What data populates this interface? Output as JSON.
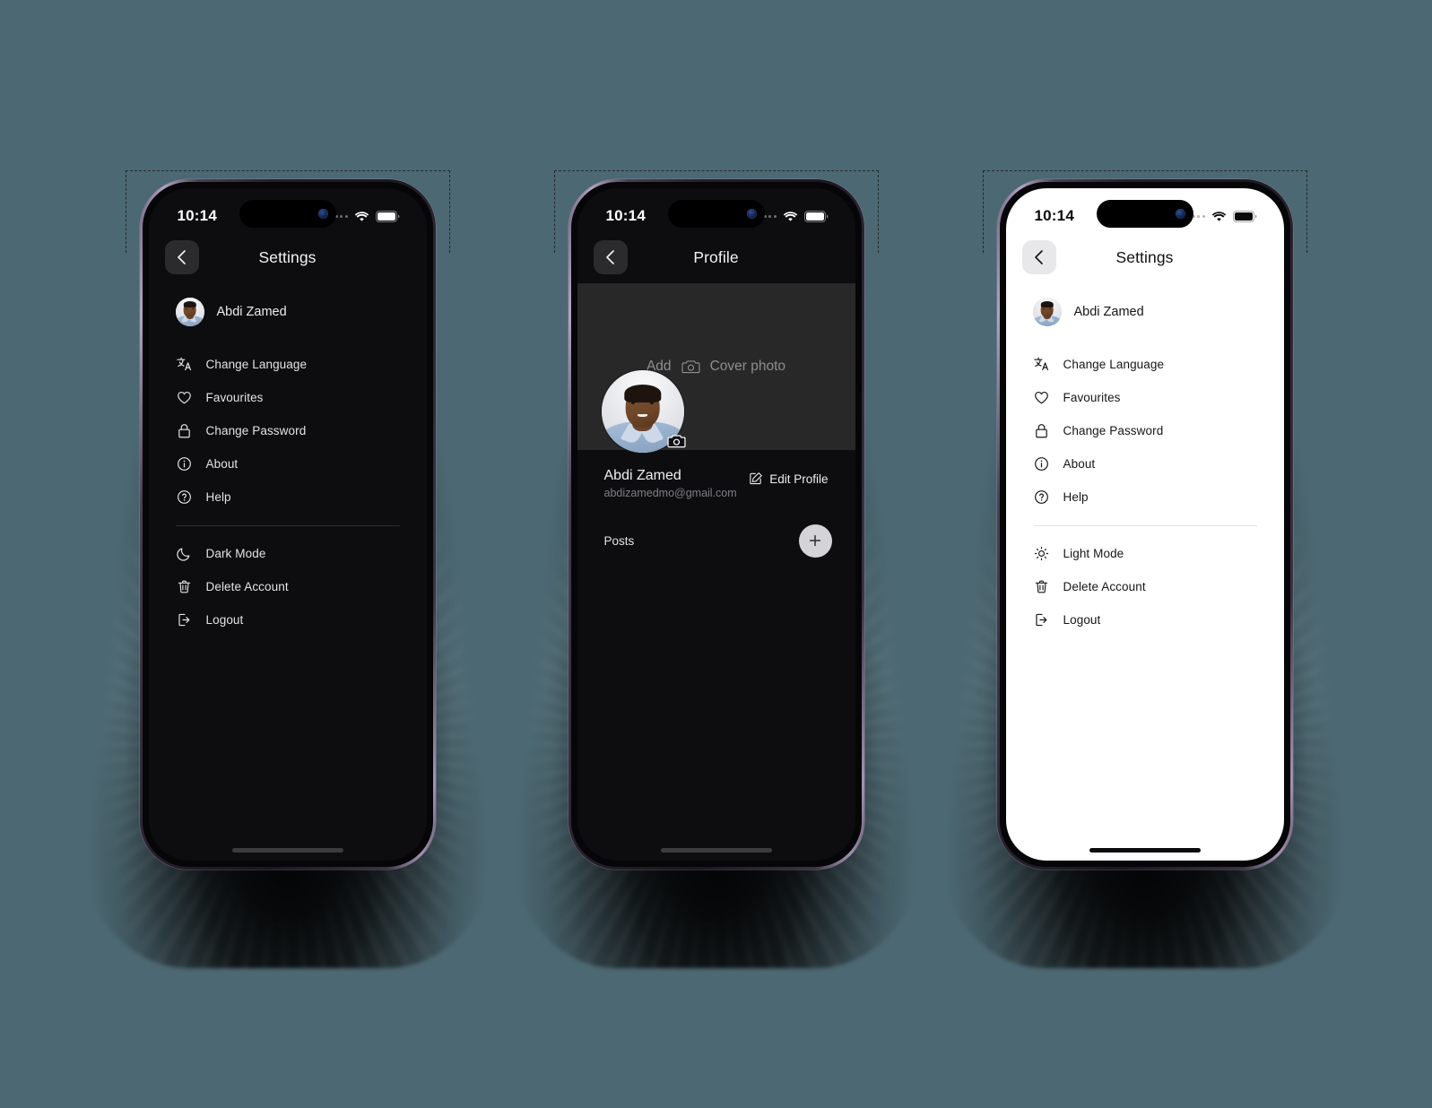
{
  "background_color": "#4c6872",
  "status_bar": {
    "time": "10:14",
    "signal_icon": "signal-dots-icon",
    "wifi_icon": "wifi-icon",
    "battery_icon": "battery-full-icon"
  },
  "phones": [
    {
      "id": "phone-settings-dark",
      "theme": "dark",
      "screen": "settings",
      "nav": {
        "title": "Settings",
        "back_icon": "chevron-left-icon"
      },
      "user": {
        "name": "Abdi Zamed",
        "avatar_icon": "user-avatar"
      },
      "menu_groups": [
        {
          "items": [
            {
              "label": "Change Language",
              "icon": "translate-icon"
            },
            {
              "label": "Favourites",
              "icon": "heart-icon"
            },
            {
              "label": "Change Password",
              "icon": "lock-icon"
            },
            {
              "label": "About",
              "icon": "info-circle-icon"
            },
            {
              "label": "Help",
              "icon": "question-circle-icon"
            }
          ]
        },
        {
          "items": [
            {
              "label": "Dark Mode",
              "icon": "moon-icon"
            },
            {
              "label": "Delete Account",
              "icon": "trash-icon"
            },
            {
              "label": "Logout",
              "icon": "logout-icon"
            }
          ]
        }
      ]
    },
    {
      "id": "phone-profile-dark",
      "theme": "dark",
      "screen": "profile",
      "nav": {
        "title": "Profile",
        "back_icon": "chevron-left-icon"
      },
      "cover": {
        "cta_prefix": "Add",
        "cta_suffix": "Cover photo",
        "camera_icon": "camera-icon"
      },
      "profile": {
        "name": "Abdi Zamed",
        "email": "abdizamedmo@gmail.com",
        "avatar_icon": "user-avatar",
        "avatar_camera_icon": "camera-icon",
        "edit_label": "Edit Profile",
        "edit_icon": "pencil-square-icon"
      },
      "posts": {
        "label": "Posts",
        "add_label": "+",
        "add_icon": "plus-icon"
      }
    },
    {
      "id": "phone-settings-light",
      "theme": "light",
      "screen": "settings",
      "nav": {
        "title": "Settings",
        "back_icon": "chevron-left-icon"
      },
      "user": {
        "name": "Abdi Zamed",
        "avatar_icon": "user-avatar"
      },
      "menu_groups": [
        {
          "items": [
            {
              "label": "Change Language",
              "icon": "translate-icon"
            },
            {
              "label": "Favourites",
              "icon": "heart-icon"
            },
            {
              "label": "Change Password",
              "icon": "lock-icon"
            },
            {
              "label": "About",
              "icon": "info-circle-icon"
            },
            {
              "label": "Help",
              "icon": "question-circle-icon"
            }
          ]
        },
        {
          "items": [
            {
              "label": "Light Mode",
              "icon": "sun-icon"
            },
            {
              "label": "Delete Account",
              "icon": "trash-icon"
            },
            {
              "label": "Logout",
              "icon": "logout-icon"
            }
          ]
        }
      ]
    }
  ]
}
